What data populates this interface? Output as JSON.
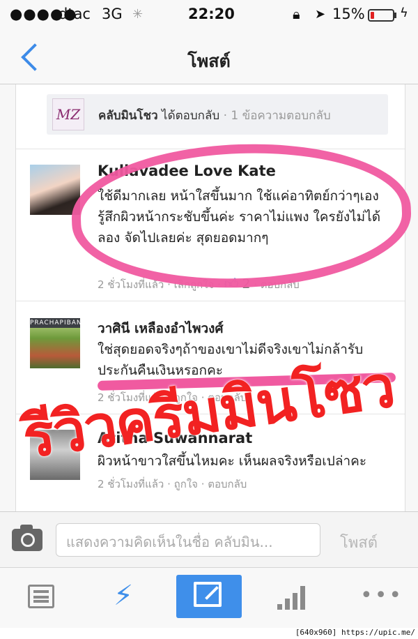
{
  "status": {
    "signal": "●●●●●",
    "carrier": "dtac",
    "network": "3G",
    "activity": "✳",
    "time": "22:20",
    "battery_label": "15%",
    "battery_level": 0.15,
    "battery_color": "#e02020"
  },
  "nav": {
    "back_icon": "chevron-left-icon",
    "title": "โพสต์"
  },
  "reply_strip": {
    "page_logo_text": "MZ",
    "page_name": "คลับมินโชว",
    "action": "ได้ตอบกลับ",
    "count": "· 1 ข้อความตอบกลับ"
  },
  "comments": [
    {
      "name": "Kullavadee Love Kate",
      "text": "ใช้ดีมากเลย หน้าใสขึ้นมาก ใช้แค่อาทิตย์กว่าๆเอง รู้สึกผิวหน้ากระชับขึ้นค่ะ ราคาไม่แพง ใครยังไม่ได้ลอง จัดไปเลยค่ะ สุดยอดมากๆ",
      "meta": "2 ชั่วโมงที่แล้ว · เลิกถูกใจ ·",
      "likes": "2",
      "reply": "· ตอบกลับ"
    },
    {
      "avatar_tag": "PRACHAPIBAN",
      "name": "วาศินี เหลืองอำไพวงศ์",
      "text": "ใช่สุดยอดจริงๆถ้าของเขาไม่ดีจริงเขาไม่กล้ารับประกันคืนเงินหรอกคะ",
      "meta": "2 ชั่วโมงที่แล้ว · ถูกใจ · ตอบกลับ"
    },
    {
      "name": "Atitha Suwannarat",
      "text": "ผิวหน้าขาวใสขึ้นไหมคะ เห็นผลจริงหรือเปล่าคะ",
      "meta": "2 ชั่วโมงที่แล้ว · ถูกใจ · ตอบกลับ"
    }
  ],
  "composer": {
    "camera_icon": "camera-icon",
    "placeholder": "แสดงความคิดเห็นในชื่อ คลับมิน...",
    "post_label": "โพสต์"
  },
  "tabbar": {
    "icons": [
      "news-feed-icon",
      "lightning-icon",
      "compose-icon",
      "stats-icon",
      "more-icon"
    ],
    "active_color": "#3f8fea"
  },
  "overlay": {
    "caption": "รีวิวครีมมินโซว",
    "caption_color": "#f22222",
    "marker_color": "#f05aa0"
  },
  "watermark": "[640x960] https://upic.me/"
}
